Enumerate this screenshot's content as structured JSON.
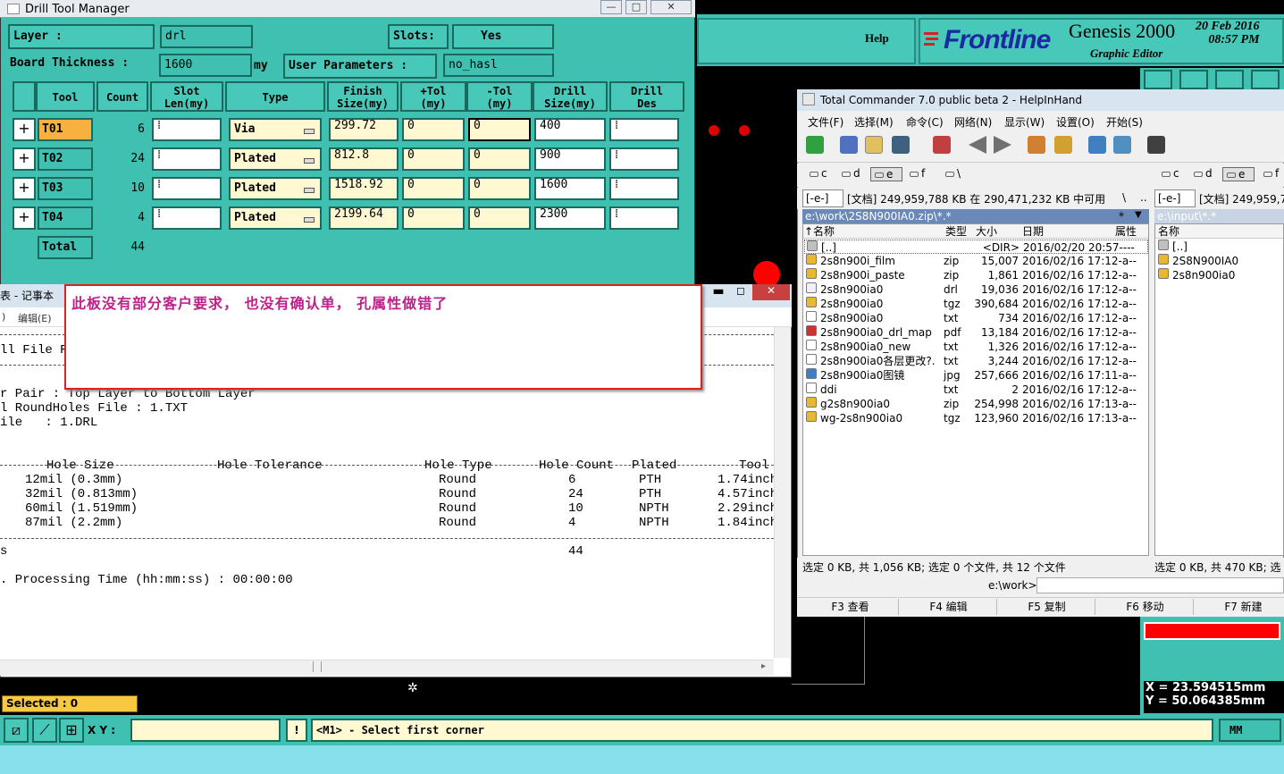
{
  "genesis": {
    "help_label": "Help",
    "brand": "Frontline",
    "product": "Genesis 2000",
    "subtitle": "Graphic Editor",
    "date": "20 Feb 2016",
    "time": "08:57 PM",
    "selected_text": "Selected : 0",
    "xy_label": "X Y :",
    "xy_value": "",
    "excl": "!",
    "message": "<M1> - Select first corner",
    "units": "MM",
    "coord_x": "X  =  23.594515mm",
    "coord_y": "Y  =  50.064385mm"
  },
  "drill_tool_manager": {
    "title": "Drill Tool Manager",
    "layer_label": "Layer          :",
    "layer_value": "drl",
    "slots_label": "Slots:",
    "slots_value": "Yes",
    "board_thickness_label": "Board Thickness :",
    "board_thickness_value": "1600",
    "board_thickness_unit": "my",
    "user_params_label": "User Parameters :",
    "user_params_value": "no_hasl",
    "headers": [
      "Tool",
      "Count",
      "Slot\nLen(my)",
      "Type",
      "Finish\nSize(my)",
      "+Tol\n(my)",
      "-Tol\n(my)",
      "Drill\nSize(my)",
      "Drill\nDes"
    ],
    "rows": [
      {
        "tool": "T01",
        "count": "6",
        "type": "Via",
        "finish": "299.72",
        "ptol": "0",
        "mtol": "0",
        "drill": "400"
      },
      {
        "tool": "T02",
        "count": "24",
        "type": "Plated",
        "finish": "812.8",
        "ptol": "0",
        "mtol": "0",
        "drill": "900"
      },
      {
        "tool": "T03",
        "count": "10",
        "type": "Plated",
        "finish": "1518.92",
        "ptol": "0",
        "mtol": "0",
        "drill": "1600"
      },
      {
        "tool": "T04",
        "count": "4",
        "type": "Plated",
        "finish": "2199.64",
        "ptol": "0",
        "mtol": "0",
        "drill": "2300"
      }
    ],
    "total_label": "Total",
    "total_count": "44"
  },
  "notepad": {
    "title": "表 - 记事本",
    "menu_edit": "编辑(E)",
    "menu_prev": ")",
    "lines": [
      "ll File R",
      "r Pair : Top Layer to Bottom Layer",
      "l RoundHoles File : 1.TXT",
      "ile   : 1.DRL",
      "        Hole Size              Hole Tolerance            Hole Type        Hole Count    Plated          Tool",
      "     12mil (0.3mm)                                        Round               6          PTH          1.74inch",
      "     32mil (0.813mm)                                      Round               24         PTH          4.57inch",
      "     60mil (1.519mm)                                      Round               10         NPTH         2.29inch",
      "     87mil (2.2mm)                                        Round               4          NPTH         1.84inch",
      "s                                                                            44",
      ". Processing Time (hh:mm:ss) : 00:00:00"
    ]
  },
  "annotation": {
    "text": "此板没有部分客户要求， 也没有确认单， 孔属性做错了"
  },
  "total_commander": {
    "title": "Total Commander 7.0 public beta 2 - HelpInHand",
    "menu": [
      "文件(F)",
      "选择(M)",
      "命令(C)",
      "网络(N)",
      "显示(W)",
      "设置(O)",
      "开始(S)"
    ],
    "drives_left": [
      "c",
      "d",
      "e",
      "f",
      "\\"
    ],
    "drives_right": [
      "c",
      "d",
      "e",
      "f"
    ],
    "drive_sel": "[-e-]",
    "free_info": "[文档]  249,959,788 KB 在 290,471,232 KB 中可用",
    "free_info_right": "[文档]  249,959,7",
    "left_path": "e:\\work\\2S8N900IA0.zip\\*.*",
    "right_path": "e:\\input\\*.*",
    "star": "*",
    "col_name": "↑名称",
    "col_type": "类型",
    "col_size": "大小",
    "col_date": "日期",
    "col_attr": "属性",
    "right_col_name": "名称",
    "files": [
      {
        "name": "[..]",
        "ext": "",
        "size": "<DIR>",
        "date": "2016/02/20 20:57----",
        "icon": "up"
      },
      {
        "name": "2s8n900i_film",
        "ext": "zip",
        "size": "15,007",
        "date": "2016/02/16 17:12-a--",
        "icon": "zip"
      },
      {
        "name": "2s8n900i_paste",
        "ext": "zip",
        "size": "1,861",
        "date": "2016/02/16 17:12-a--",
        "icon": "zip"
      },
      {
        "name": "2s8n900ia0",
        "ext": "drl",
        "size": "19,036",
        "date": "2016/02/16 17:12-a--",
        "icon": "file"
      },
      {
        "name": "2s8n900ia0",
        "ext": "tgz",
        "size": "390,684",
        "date": "2016/02/16 17:12-a--",
        "icon": "zip"
      },
      {
        "name": "2s8n900ia0",
        "ext": "txt",
        "size": "734",
        "date": "2016/02/16 17:12-a--",
        "icon": "txt"
      },
      {
        "name": "2s8n900ia0_drl_map",
        "ext": "pdf",
        "size": "13,184",
        "date": "2016/02/16 17:12-a--",
        "icon": "pdf"
      },
      {
        "name": "2s8n900ia0_new",
        "ext": "txt",
        "size": "1,326",
        "date": "2016/02/16 17:12-a--",
        "icon": "txt"
      },
      {
        "name": "2s8n900ia0各层更改?.",
        "ext": "txt",
        "size": "3,244",
        "date": "2016/02/16 17:12-a--",
        "icon": "txt"
      },
      {
        "name": "2s8n900ia0图镜",
        "ext": "jpg",
        "size": "257,666",
        "date": "2016/02/16 17:11-a--",
        "icon": "img"
      },
      {
        "name": "ddi",
        "ext": "txt",
        "size": "2",
        "date": "2016/02/16 17:12-a--",
        "icon": "txt"
      },
      {
        "name": "g2s8n900ia0",
        "ext": "zip",
        "size": "254,998",
        "date": "2016/02/16 17:13-a--",
        "icon": "zip"
      },
      {
        "name": "wg-2s8n900ia0",
        "ext": "tgz",
        "size": "123,960",
        "date": "2016/02/16 17:13-a--",
        "icon": "zip"
      }
    ],
    "right_files": [
      "[..]",
      "2S8N900IA0",
      "2s8n900ia0"
    ],
    "status_left": "选定 0 KB, 共 1,056 KB; 选定 0 个文件, 共 12 个文件",
    "status_right": "选定 0 KB, 共 470 KB; 选",
    "cmd_prompt": "e:\\work>",
    "fkeys": [
      "F3 查看",
      "F4 编辑",
      "F5 复制",
      "F6 移动",
      "F7 新建"
    ]
  }
}
